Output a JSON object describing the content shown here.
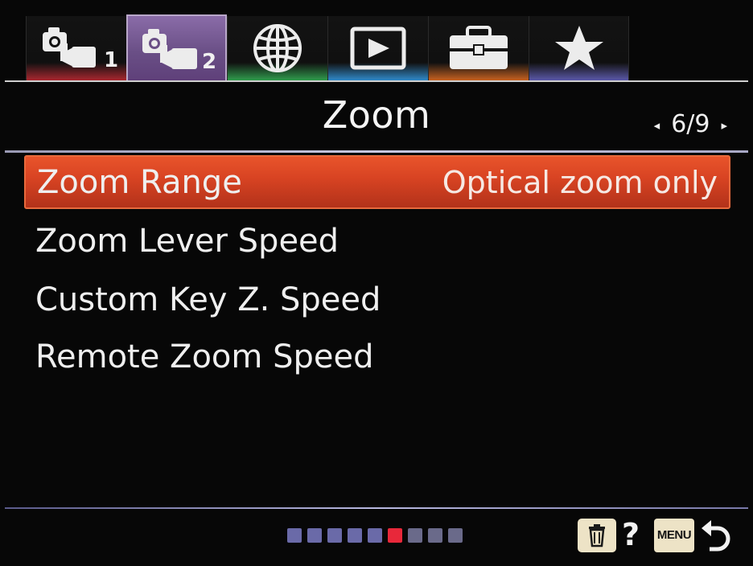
{
  "tabs": [
    {
      "icon": "camera-settings-icon",
      "number": "1",
      "stripe": "#a8262e",
      "active": false
    },
    {
      "icon": "camera-settings-icon",
      "number": "2",
      "stripe": "#7a3f8c",
      "active": true
    },
    {
      "icon": "globe-icon",
      "number": "",
      "stripe": "#2f9b4c",
      "active": false
    },
    {
      "icon": "playback-icon",
      "number": "",
      "stripe": "#2f88c8",
      "active": false
    },
    {
      "icon": "toolbox-icon",
      "number": "",
      "stripe": "#c7611f",
      "active": false
    },
    {
      "icon": "star-icon",
      "number": "",
      "stripe": "#5a58a8",
      "active": false
    }
  ],
  "header": {
    "title": "Zoom",
    "page": "6/9",
    "prev_arrow": "◂",
    "next_arrow": "▸"
  },
  "menu": {
    "items": [
      {
        "label": "Zoom Range",
        "value": "Optical zoom only",
        "selected": true
      },
      {
        "label": "Zoom Lever Speed",
        "value": "",
        "selected": false
      },
      {
        "label": "Custom Key Z. Speed",
        "value": "",
        "selected": false
      },
      {
        "label": "Remote Zoom Speed",
        "value": "",
        "selected": false
      }
    ]
  },
  "footer": {
    "page_dots": [
      {
        "color": "#6a6aa8",
        "current": false
      },
      {
        "color": "#6a6aa8",
        "current": false
      },
      {
        "color": "#6a6aa8",
        "current": false
      },
      {
        "color": "#6a6aa8",
        "current": false
      },
      {
        "color": "#6a6aa8",
        "current": false
      },
      {
        "color": "#e8283a",
        "current": true
      },
      {
        "color": "#6a6a8a",
        "current": false
      },
      {
        "color": "#6a6a8a",
        "current": false
      },
      {
        "color": "#6a6a8a",
        "current": false
      }
    ],
    "help": "?",
    "menu_label": "MENU",
    "icons": {
      "delete": "trash-icon",
      "back": "back-arrow-icon"
    }
  }
}
